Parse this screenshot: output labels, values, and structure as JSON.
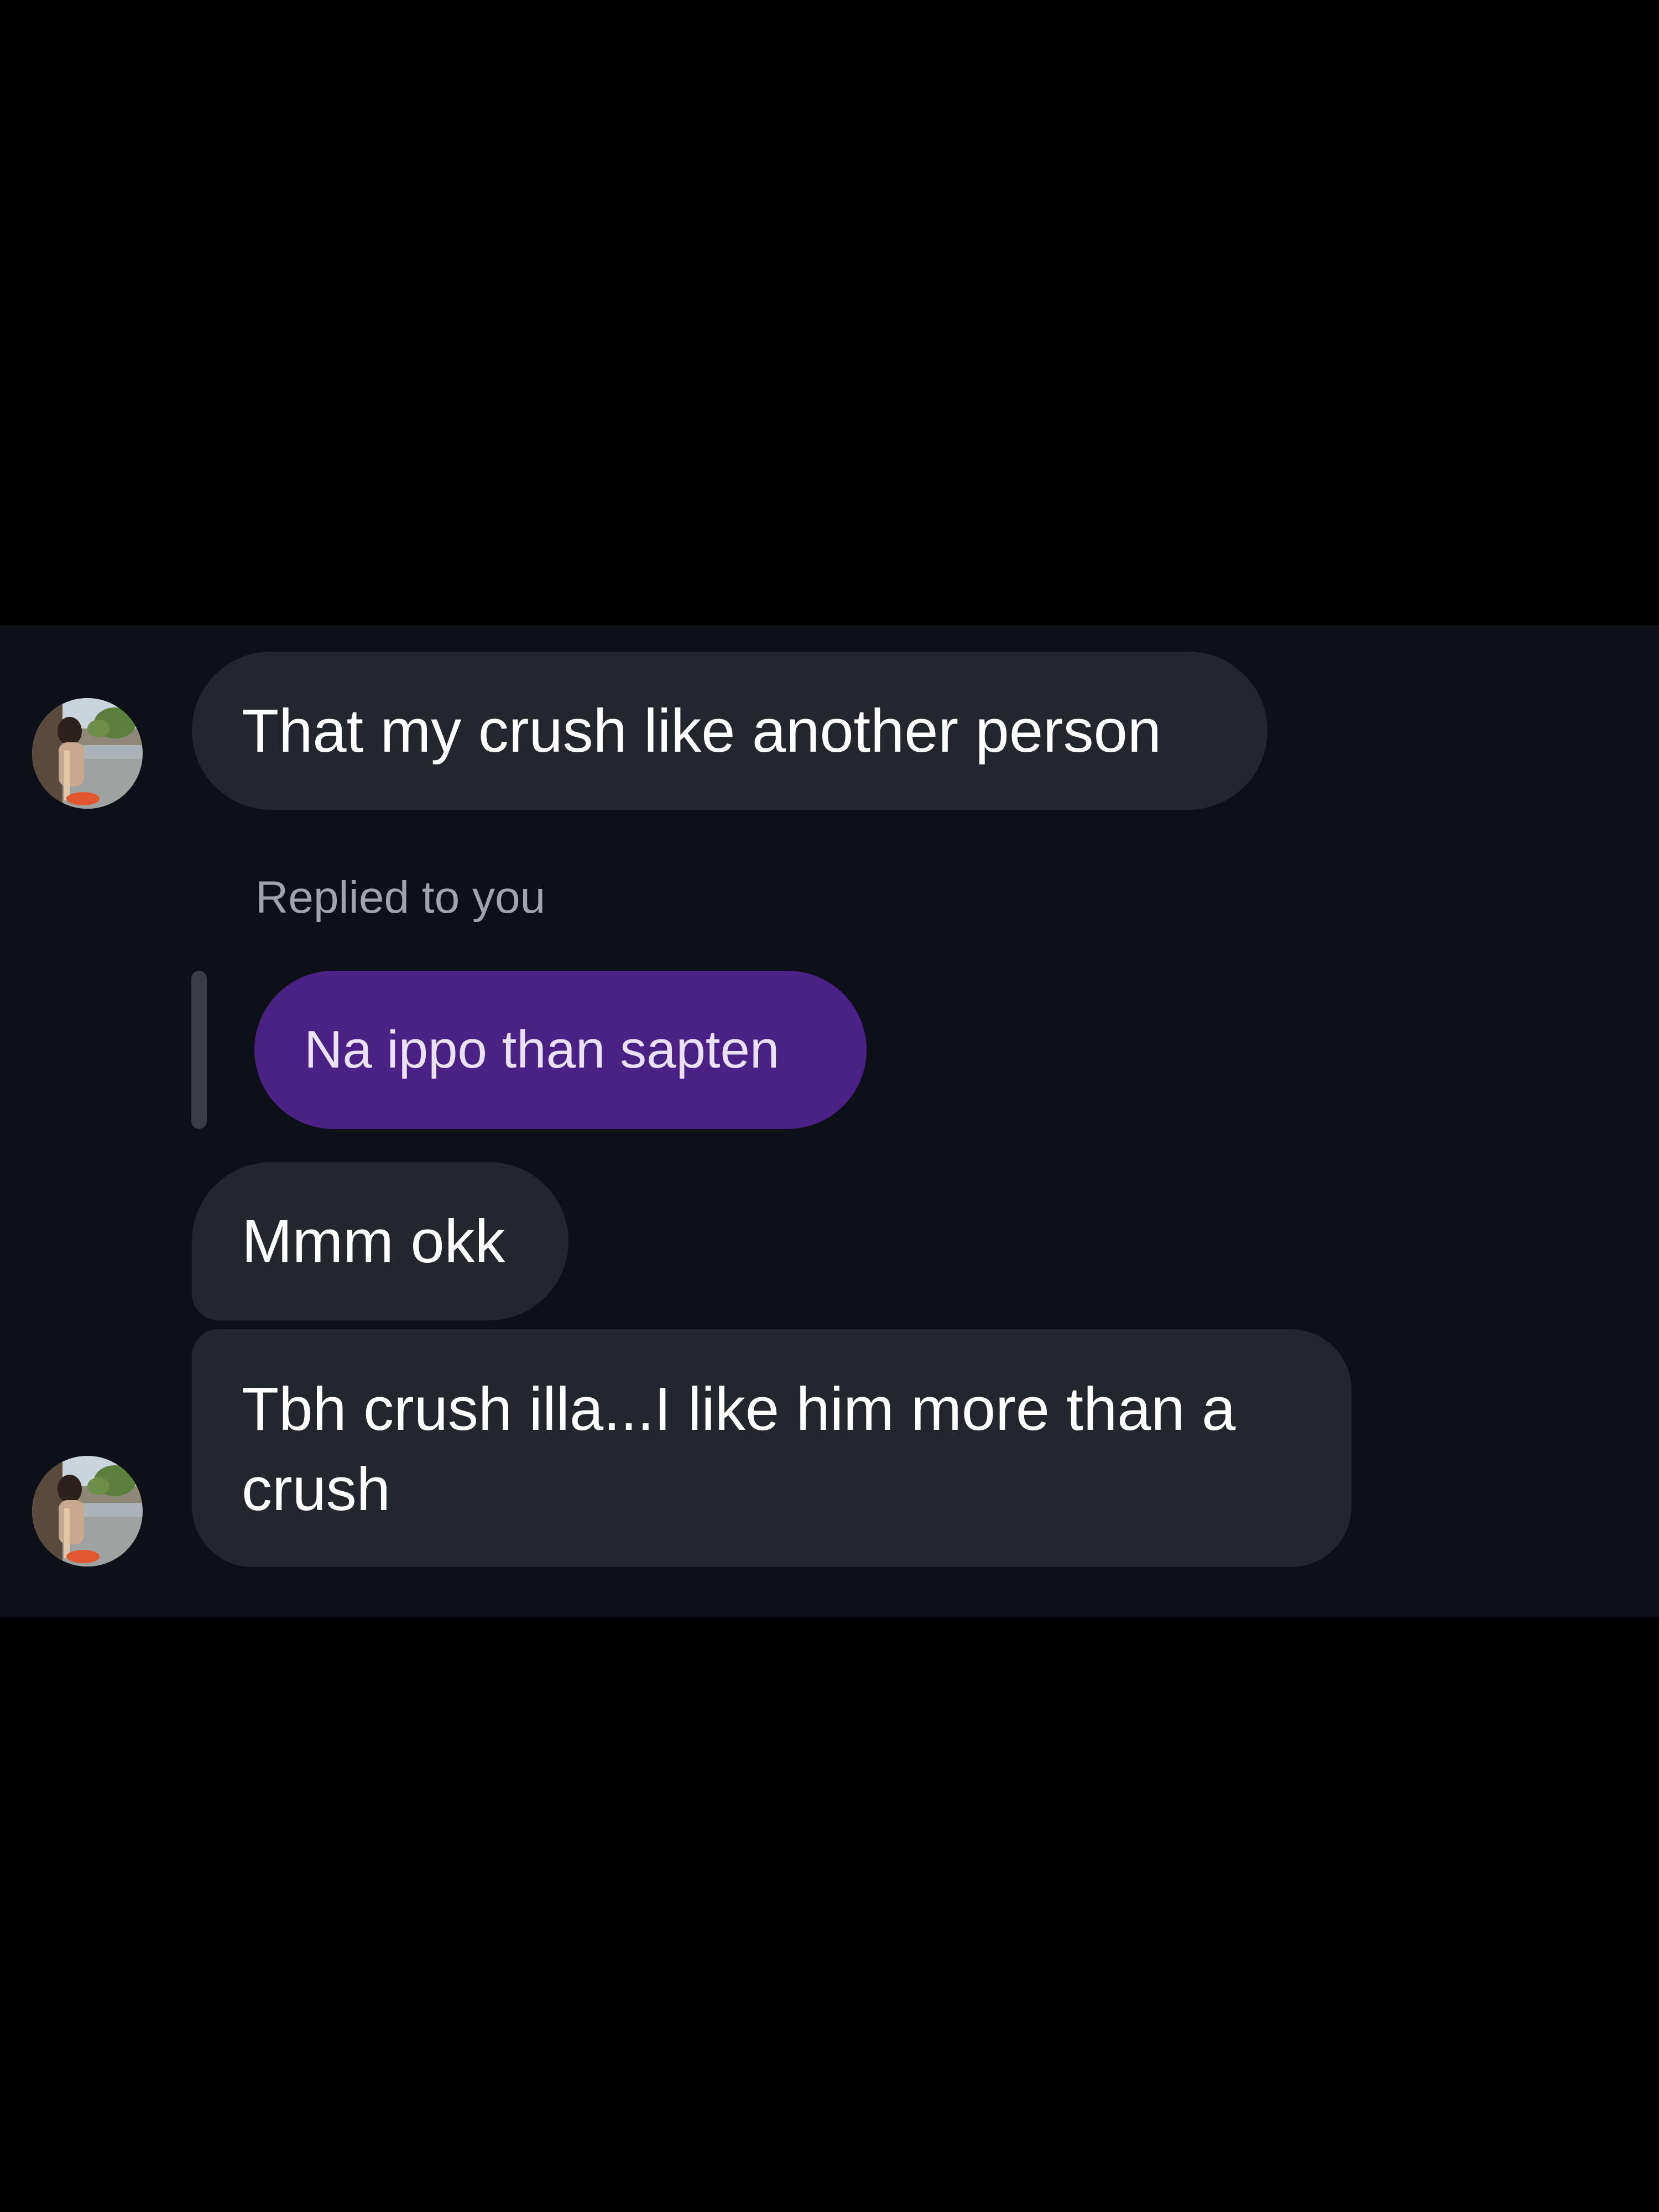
{
  "messages": [
    {
      "text": "That my crush like another person"
    },
    {
      "text": "Na ippo than sapten",
      "reply_label": "Replied to you"
    },
    {
      "text": "Mmm okk"
    },
    {
      "text": "Tbh crush illa...I like him more than a crush"
    }
  ],
  "colors": {
    "background": "#000000",
    "chat_background": "#0d1017",
    "incoming_bubble": "#24262d",
    "outgoing_bubble": "#4a2285",
    "secondary_text": "#a0a4ad"
  },
  "icons": {
    "avatar": "contact-avatar-photo"
  }
}
